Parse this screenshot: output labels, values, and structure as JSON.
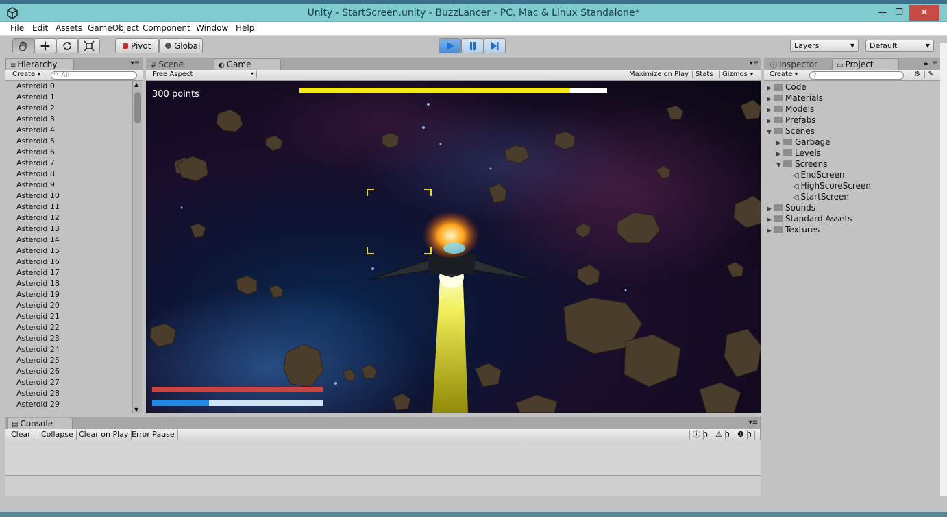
{
  "window": {
    "title": "Unity - StartScreen.unity - BuzzLancer - PC, Mac & Linux Standalone*",
    "min_glyph": "—",
    "max_glyph": "❐",
    "close_glyph": "✕"
  },
  "menu": [
    "File",
    "Edit",
    "Assets",
    "GameObject",
    "Component",
    "Window",
    "Help"
  ],
  "toolbar": {
    "pivot": "Pivot",
    "global": "Global",
    "layers": "Layers",
    "layout": "Default"
  },
  "hierarchy": {
    "tab": "Hierarchy",
    "create": "Create",
    "search_placeholder": "All",
    "items": [
      "Asteroid 0",
      "Asteroid 1",
      "Asteroid 2",
      "Asteroid 3",
      "Asteroid 4",
      "Asteroid 5",
      "Asteroid 6",
      "Asteroid 7",
      "Asteroid 8",
      "Asteroid 9",
      "Asteroid 10",
      "Asteroid 11",
      "Asteroid 12",
      "Asteroid 13",
      "Asteroid 14",
      "Asteroid 15",
      "Asteroid 16",
      "Asteroid 17",
      "Asteroid 18",
      "Asteroid 19",
      "Asteroid 20",
      "Asteroid 21",
      "Asteroid 22",
      "Asteroid 23",
      "Asteroid 24",
      "Asteroid 25",
      "Asteroid 26",
      "Asteroid 27",
      "Asteroid 28",
      "Asteroid 29"
    ]
  },
  "center": {
    "scene_tab": "Scene",
    "game_tab": "Game",
    "aspect": "Free Aspect",
    "maximize": "Maximize on Play",
    "stats": "Stats",
    "gizmos": "Gizmos"
  },
  "game": {
    "points_label": "300 points",
    "boost_fraction": 0.88,
    "health_fraction": 1.0,
    "shield_fraction": 0.33,
    "colors": {
      "boost": "#f5ea1a",
      "health": "#c84545",
      "shield": "#1e88e5",
      "shield_bg": "#d0e4f5"
    }
  },
  "inspector": {
    "tab": "Inspector"
  },
  "project": {
    "tab": "Project",
    "create": "Create",
    "tree": [
      {
        "label": "Code",
        "level": 0,
        "kind": "folder",
        "expanded": false
      },
      {
        "label": "Materials",
        "level": 0,
        "kind": "folder",
        "expanded": false
      },
      {
        "label": "Models",
        "level": 0,
        "kind": "folder",
        "expanded": false
      },
      {
        "label": "Prefabs",
        "level": 0,
        "kind": "folder",
        "expanded": false
      },
      {
        "label": "Scenes",
        "level": 0,
        "kind": "folder",
        "expanded": true
      },
      {
        "label": "Garbage",
        "level": 1,
        "kind": "folder",
        "expanded": false
      },
      {
        "label": "Levels",
        "level": 1,
        "kind": "folder",
        "expanded": false
      },
      {
        "label": "Screens",
        "level": 1,
        "kind": "folder",
        "expanded": true
      },
      {
        "label": "EndScreen",
        "level": 2,
        "kind": "scene"
      },
      {
        "label": "HighScoreScreen",
        "level": 2,
        "kind": "scene"
      },
      {
        "label": "StartScreen",
        "level": 2,
        "kind": "scene"
      },
      {
        "label": "Sounds",
        "level": 0,
        "kind": "folder",
        "expanded": false
      },
      {
        "label": "Standard Assets",
        "level": 0,
        "kind": "folder",
        "expanded": false
      },
      {
        "label": "Textures",
        "level": 0,
        "kind": "folder",
        "expanded": false
      }
    ]
  },
  "console": {
    "tab": "Console",
    "clear": "Clear",
    "collapse": "Collapse",
    "clear_on_play": "Clear on Play",
    "error_pause": "Error Pause",
    "info_count": "0",
    "warning_count": "0",
    "error_count": "0"
  }
}
